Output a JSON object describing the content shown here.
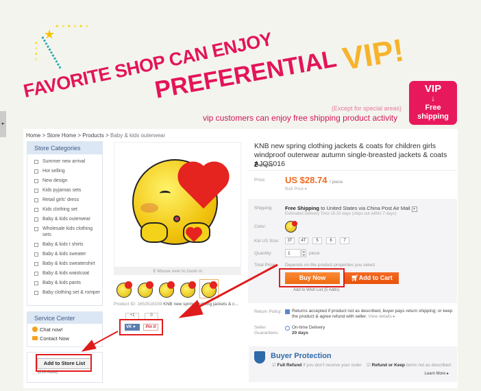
{
  "banner": {
    "line1": "FAVORITE SHOP CAN ENJOY",
    "line2": "PREFERENTIAL",
    "vip": "VIP!",
    "except": "(Except for special areas)",
    "subline": "vip customers can enjoy free shipping product activity",
    "badge": {
      "vip": "VIP",
      "arrow": "↓",
      "free": "Free",
      "shipping": "shipping"
    },
    "colors": {
      "pink": "#e3145a",
      "gold": "#f7b32b"
    }
  },
  "sidetab": {
    "icon": "▸"
  },
  "breadcrumb": [
    {
      "label": "Home"
    },
    {
      "label": "Store Home"
    },
    {
      "label": "Products"
    },
    {
      "label": "Baby & kids outerwear"
    }
  ],
  "breadcrumb_sep": " > ",
  "sidebar": {
    "title": "Store Categories",
    "items": [
      "Summer new arrival",
      "Hot selling",
      "New design",
      "Kids pyjamas sets",
      "Retail girls' dress",
      "Kids clothing set",
      "Baby & kids outerwear",
      "Wholesale kids clothing sets",
      "Baby & kids t shirts",
      "Baby & kids sweater",
      "Baby & kids sweatershirt",
      "Baby & kids waistcoat",
      "Baby & kids pants",
      "Baby clothing set & romper"
    ]
  },
  "service": {
    "title": "Service Center",
    "chat": "Chat now!",
    "contact": "Contact Now"
  },
  "store": {
    "button": "Add to Store List",
    "adds": "(216 Adds)"
  },
  "gallery": {
    "zoom_hint": "Mouse over to zoom in",
    "product_id_label": "Product ID: 1653518159",
    "product_id_name": "KNB new spring clothing jackets & c...",
    "social": {
      "plus": "+1",
      "count": "0",
      "vk": "VK ♥",
      "pin": "Pin it"
    }
  },
  "product": {
    "title": "KNB new spring clothing jackets & coats for children girls windproof outerwear autumn single-breasted jackets & coats AJQS016",
    "orders_count": "2",
    "orders_label": "orders",
    "price_label": "Price:",
    "price": "US $28.74",
    "price_unit": "/ piece",
    "bulk": "Bulk Price ▾",
    "shipping_label": "Shipping:",
    "shipping_free": "Free Shipping",
    "shipping_to": "to United States via China Post Air Mail",
    "shipping_est": "Estimated Delivery Time 15-20 days (ships out within 7 days)",
    "color_label": "Color:",
    "size_label": "Kid US Size:",
    "sizes": [
      "3T",
      "4T",
      "5",
      "6",
      "7"
    ],
    "qty_label": "Quantity:",
    "qty": "1",
    "qty_unit": "piece",
    "total_label": "Total Price:",
    "total": "Depends on the product properties you select",
    "buy_now": "Buy Now",
    "add_cart": "Add to Cart",
    "wish": "Add to Wish List (5 Adds)",
    "return_label": "Return Policy:",
    "return_text": "Returns accepted if product not as described, buyer pays return shipping; or keep the product & agree refund with seller.",
    "view_details": "View details ▸",
    "seller_label": "Seller Guarantees:",
    "ontime": "On-time Delivery",
    "days": "20 days"
  },
  "protection": {
    "title": "Buyer Protection",
    "full_refund": "Full Refund",
    "full_refund_text": "if you don't receive your order",
    "refund_keep": "Refund or Keep",
    "refund_keep_text": "items not as described",
    "learn_more": "Learn More ▸"
  },
  "colors": {
    "accent": "#f06a1e",
    "highlight": "#e01b1b",
    "link": "#2f6aa8"
  }
}
